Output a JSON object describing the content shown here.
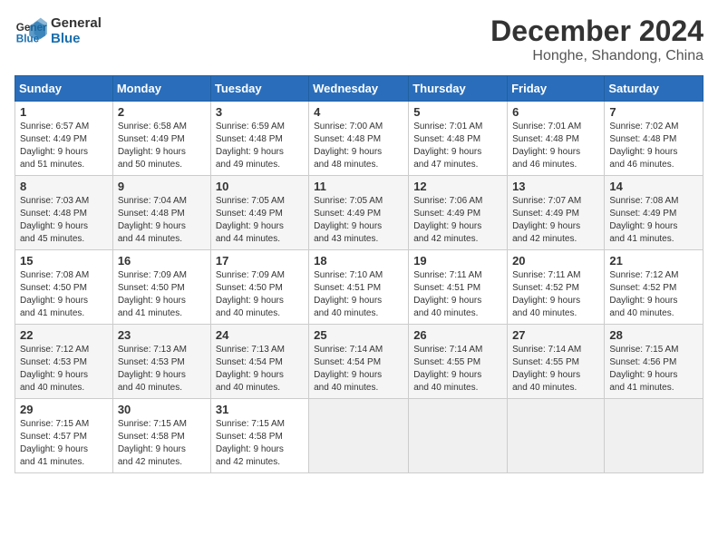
{
  "logo": {
    "line1": "General",
    "line2": "Blue"
  },
  "title": "December 2024",
  "subtitle": "Honghe, Shandong, China",
  "weekdays": [
    "Sunday",
    "Monday",
    "Tuesday",
    "Wednesday",
    "Thursday",
    "Friday",
    "Saturday"
  ],
  "weeks": [
    [
      {
        "day": "1",
        "sunrise": "6:57 AM",
        "sunset": "4:49 PM",
        "daylight": "9 hours and 51 minutes."
      },
      {
        "day": "2",
        "sunrise": "6:58 AM",
        "sunset": "4:49 PM",
        "daylight": "9 hours and 50 minutes."
      },
      {
        "day": "3",
        "sunrise": "6:59 AM",
        "sunset": "4:48 PM",
        "daylight": "9 hours and 49 minutes."
      },
      {
        "day": "4",
        "sunrise": "7:00 AM",
        "sunset": "4:48 PM",
        "daylight": "9 hours and 48 minutes."
      },
      {
        "day": "5",
        "sunrise": "7:01 AM",
        "sunset": "4:48 PM",
        "daylight": "9 hours and 47 minutes."
      },
      {
        "day": "6",
        "sunrise": "7:01 AM",
        "sunset": "4:48 PM",
        "daylight": "9 hours and 46 minutes."
      },
      {
        "day": "7",
        "sunrise": "7:02 AM",
        "sunset": "4:48 PM",
        "daylight": "9 hours and 46 minutes."
      }
    ],
    [
      {
        "day": "8",
        "sunrise": "7:03 AM",
        "sunset": "4:48 PM",
        "daylight": "9 hours and 45 minutes."
      },
      {
        "day": "9",
        "sunrise": "7:04 AM",
        "sunset": "4:48 PM",
        "daylight": "9 hours and 44 minutes."
      },
      {
        "day": "10",
        "sunrise": "7:05 AM",
        "sunset": "4:49 PM",
        "daylight": "9 hours and 44 minutes."
      },
      {
        "day": "11",
        "sunrise": "7:05 AM",
        "sunset": "4:49 PM",
        "daylight": "9 hours and 43 minutes."
      },
      {
        "day": "12",
        "sunrise": "7:06 AM",
        "sunset": "4:49 PM",
        "daylight": "9 hours and 42 minutes."
      },
      {
        "day": "13",
        "sunrise": "7:07 AM",
        "sunset": "4:49 PM",
        "daylight": "9 hours and 42 minutes."
      },
      {
        "day": "14",
        "sunrise": "7:08 AM",
        "sunset": "4:49 PM",
        "daylight": "9 hours and 41 minutes."
      }
    ],
    [
      {
        "day": "15",
        "sunrise": "7:08 AM",
        "sunset": "4:50 PM",
        "daylight": "9 hours and 41 minutes."
      },
      {
        "day": "16",
        "sunrise": "7:09 AM",
        "sunset": "4:50 PM",
        "daylight": "9 hours and 41 minutes."
      },
      {
        "day": "17",
        "sunrise": "7:09 AM",
        "sunset": "4:50 PM",
        "daylight": "9 hours and 40 minutes."
      },
      {
        "day": "18",
        "sunrise": "7:10 AM",
        "sunset": "4:51 PM",
        "daylight": "9 hours and 40 minutes."
      },
      {
        "day": "19",
        "sunrise": "7:11 AM",
        "sunset": "4:51 PM",
        "daylight": "9 hours and 40 minutes."
      },
      {
        "day": "20",
        "sunrise": "7:11 AM",
        "sunset": "4:52 PM",
        "daylight": "9 hours and 40 minutes."
      },
      {
        "day": "21",
        "sunrise": "7:12 AM",
        "sunset": "4:52 PM",
        "daylight": "9 hours and 40 minutes."
      }
    ],
    [
      {
        "day": "22",
        "sunrise": "7:12 AM",
        "sunset": "4:53 PM",
        "daylight": "9 hours and 40 minutes."
      },
      {
        "day": "23",
        "sunrise": "7:13 AM",
        "sunset": "4:53 PM",
        "daylight": "9 hours and 40 minutes."
      },
      {
        "day": "24",
        "sunrise": "7:13 AM",
        "sunset": "4:54 PM",
        "daylight": "9 hours and 40 minutes."
      },
      {
        "day": "25",
        "sunrise": "7:14 AM",
        "sunset": "4:54 PM",
        "daylight": "9 hours and 40 minutes."
      },
      {
        "day": "26",
        "sunrise": "7:14 AM",
        "sunset": "4:55 PM",
        "daylight": "9 hours and 40 minutes."
      },
      {
        "day": "27",
        "sunrise": "7:14 AM",
        "sunset": "4:55 PM",
        "daylight": "9 hours and 40 minutes."
      },
      {
        "day": "28",
        "sunrise": "7:15 AM",
        "sunset": "4:56 PM",
        "daylight": "9 hours and 41 minutes."
      }
    ],
    [
      {
        "day": "29",
        "sunrise": "7:15 AM",
        "sunset": "4:57 PM",
        "daylight": "9 hours and 41 minutes."
      },
      {
        "day": "30",
        "sunrise": "7:15 AM",
        "sunset": "4:58 PM",
        "daylight": "9 hours and 42 minutes."
      },
      {
        "day": "31",
        "sunrise": "7:15 AM",
        "sunset": "4:58 PM",
        "daylight": "9 hours and 42 minutes."
      },
      null,
      null,
      null,
      null
    ]
  ]
}
